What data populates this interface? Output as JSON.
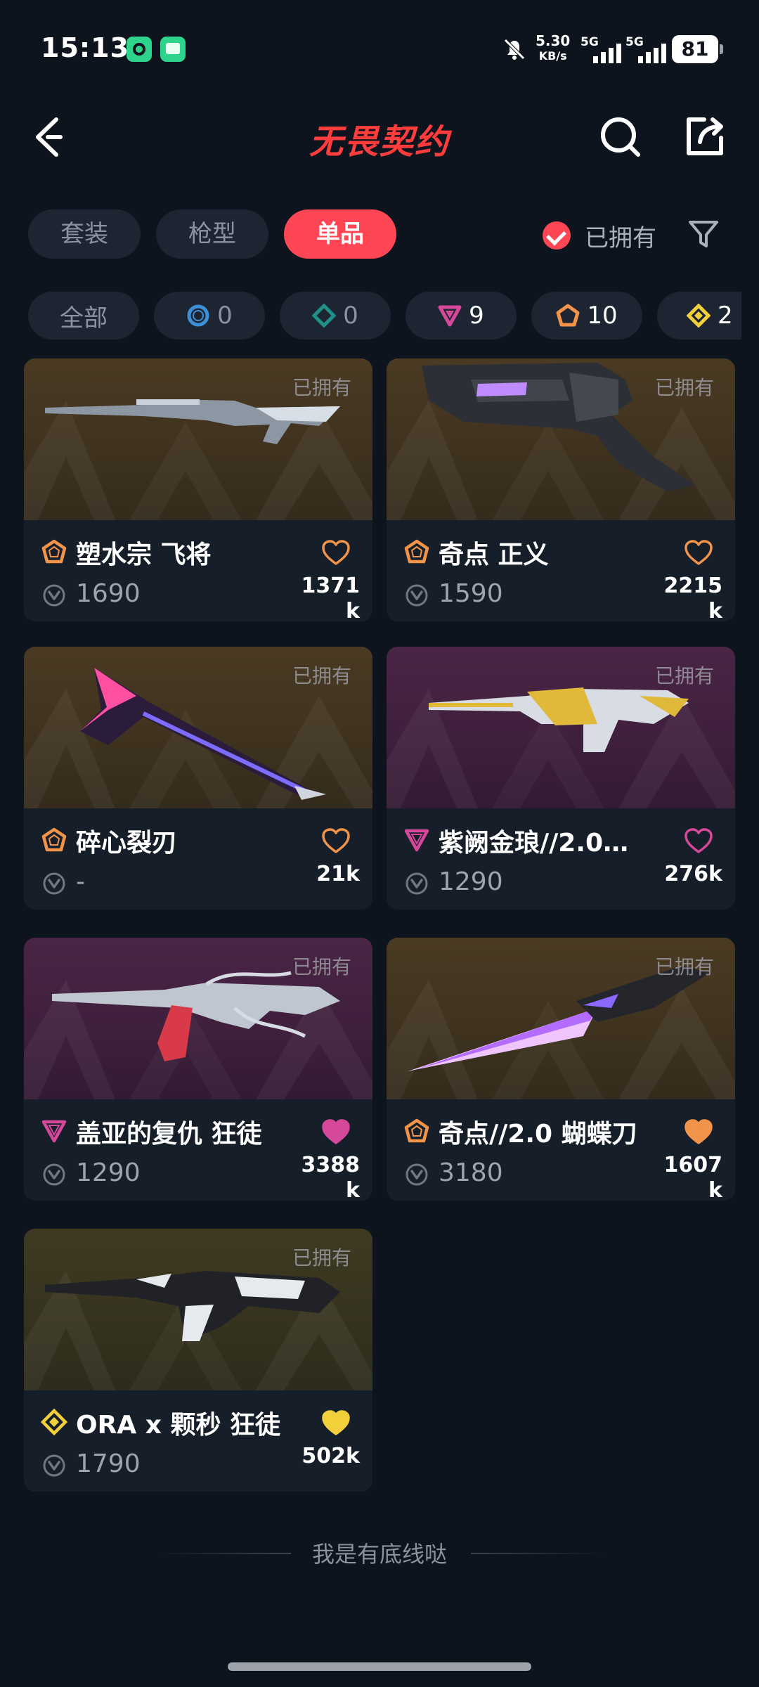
{
  "status_bar": {
    "time": "15:13",
    "net_speed_value": "5.30",
    "net_speed_unit": "KB/s",
    "signal1_label": "5G",
    "signal2_label": "5G",
    "battery": "81"
  },
  "header": {
    "title": "无畏契约",
    "back_icon": "chevron-left-icon",
    "search_icon": "search-icon",
    "share_icon": "share-icon"
  },
  "tabs": [
    {
      "label": "套装",
      "active": false
    },
    {
      "label": "枪型",
      "active": false
    },
    {
      "label": "单品",
      "active": true
    }
  ],
  "owned_filter": {
    "label": "已拥有",
    "checked": true
  },
  "rarity_chips": [
    {
      "label": "全部"
    },
    {
      "icon": "select-tier-icon",
      "count": "0",
      "color": "#3d8fd6"
    },
    {
      "icon": "deluxe-tier-icon",
      "count": "0",
      "color": "#1f8f87"
    },
    {
      "icon": "premium-tier-icon",
      "count": "9",
      "color": "#d6489a"
    },
    {
      "icon": "exclusive-tier-icon",
      "count": "10",
      "color": "#f2934a"
    },
    {
      "icon": "ultra-tier-icon",
      "count": "2",
      "color": "#f2d03c"
    }
  ],
  "items": [
    {
      "name": "塑水宗 飞将",
      "price": "1690",
      "likes": "1371k",
      "owned_label": "已拥有",
      "tier": "exclusive",
      "liked": false
    },
    {
      "name": "奇点 正义",
      "price": "1590",
      "likes": "2215k",
      "owned_label": "已拥有",
      "tier": "exclusive",
      "liked": false
    },
    {
      "name": "碎心裂刃",
      "price": "-",
      "likes": "21k",
      "owned_label": "已拥有",
      "tier": "exclusive",
      "liked": false
    },
    {
      "name": "紫阙金琅//2.0…",
      "price": "1290",
      "likes": "276k",
      "owned_label": "已拥有",
      "tier": "premium",
      "liked": false
    },
    {
      "name": "盖亚的复仇 狂徒",
      "price": "1290",
      "likes": "3388k",
      "owned_label": "已拥有",
      "tier": "premium",
      "liked": true
    },
    {
      "name": "奇点//2.0 蝴蝶刀",
      "price": "3180",
      "likes": "1607k",
      "owned_label": "已拥有",
      "tier": "exclusive",
      "liked": true
    },
    {
      "name": "ORA x 颗秒 狂徒",
      "price": "1790",
      "likes": "502k",
      "owned_label": "已拥有",
      "tier": "ultra",
      "liked": true
    }
  ],
  "footer": {
    "text": "我是有底线哒"
  },
  "colors": {
    "accent": "#ff4655",
    "exclusive": "#f2934a",
    "premium": "#d6489a",
    "ultra": "#f2d03c"
  }
}
